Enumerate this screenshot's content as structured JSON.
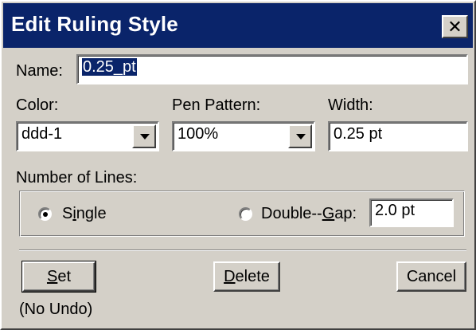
{
  "dialog": {
    "title": "Edit Ruling Style"
  },
  "name_field": {
    "label": "Name:",
    "value": "0.25_pt"
  },
  "color": {
    "label": "Color:",
    "value": "ddd-1"
  },
  "pen_pattern": {
    "label": "Pen Pattern:",
    "value": "100%"
  },
  "width": {
    "label": "Width:",
    "value": "0.25 pt"
  },
  "number_of_lines": {
    "label": "Number of Lines:",
    "single": {
      "prefix": "S",
      "mnemonic": "i",
      "suffix": "ngle",
      "selected": true
    },
    "double": {
      "prefix": "Double--",
      "mnemonic": "G",
      "suffix": "ap:",
      "selected": false
    },
    "gap_value": "2.0 pt"
  },
  "buttons": {
    "set": {
      "mnemonic": "S",
      "rest": "et"
    },
    "delete": {
      "mnemonic": "D",
      "rest": "elete"
    },
    "cancel": {
      "label": "Cancel"
    }
  },
  "no_undo_text": "(No Undo)"
}
